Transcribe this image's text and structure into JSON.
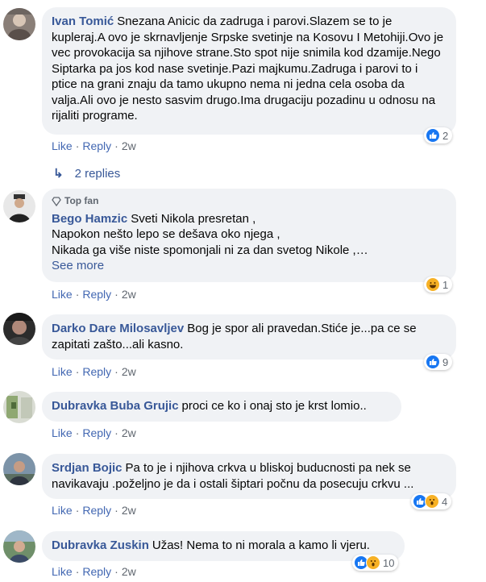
{
  "comments": [
    {
      "author": "Ivan Tomić",
      "text": "Snezana Anicic da zadruga i parovi.Slazem se to je kupleraj.A ovo je skrnavljenje Srpske svetinje na Kosovu I Metohiji.Ovo je vec provokacija sa njihove strane.Sto spot nije snimila kod dzamije.Nego Siptarka pa jos kod nase svetinje.Pazi majkumu.Zadruga i parovi to i ptice na grani znaju da tamo ukupno nema ni jedna cela osoba da valja.Ali ovo je nesto sasvim drugo.Ima drugaciju pozadinu u odnosu na rijaliti programe.",
      "like": "Like",
      "reply": "Reply",
      "time": "2w",
      "reactions": [
        "like"
      ],
      "reaction_count": "2",
      "replies_label": "2 replies"
    },
    {
      "badge": "Top fan",
      "author": "Bego Hamzic",
      "text": "Sveti Nikola presretan ,\nNapokon nešto lepo se dešava oko njega ,\nNikada ga više niste spomonjali ni za dan svetog Nikole ,…",
      "see_more": "See more",
      "like": "Like",
      "reply": "Reply",
      "time": "2w",
      "reactions": [
        "haha"
      ],
      "reaction_count": "1"
    },
    {
      "author": "Darko Dare Milosavljev",
      "text": "Bog je spor ali pravedan.Stiće je...pa ce se zapitati zašto...ali kasno.",
      "like": "Like",
      "reply": "Reply",
      "time": "2w",
      "reactions": [
        "like"
      ],
      "reaction_count": "9"
    },
    {
      "author": "Dubravka Buba Grujic",
      "text": "proci ce ko i onaj sto je krst lomio..",
      "like": "Like",
      "reply": "Reply",
      "time": "2w"
    },
    {
      "author": "Srdjan Bojic",
      "text": "Pa to je i njihova crkva u bliskoj buducnosti pa nek se navikavaju .poželjno je da i ostali šiptari počnu da posecuju crkvu ...",
      "like": "Like",
      "reply": "Reply",
      "time": "2w",
      "reactions": [
        "like",
        "wow"
      ],
      "reaction_count": "4"
    },
    {
      "author": "Dubravka Zuskin",
      "text": "Užas! Nema to ni morala a kamo li vjeru.",
      "like": "Like",
      "reply": "Reply",
      "time": "2w",
      "reactions": [
        "like",
        "wow"
      ],
      "reaction_count": "10"
    }
  ],
  "colors": {
    "link": "#385898",
    "bubble": "#f0f2f5",
    "like_blue": "#1877f2",
    "reaction_yellow": "#f7b125"
  }
}
